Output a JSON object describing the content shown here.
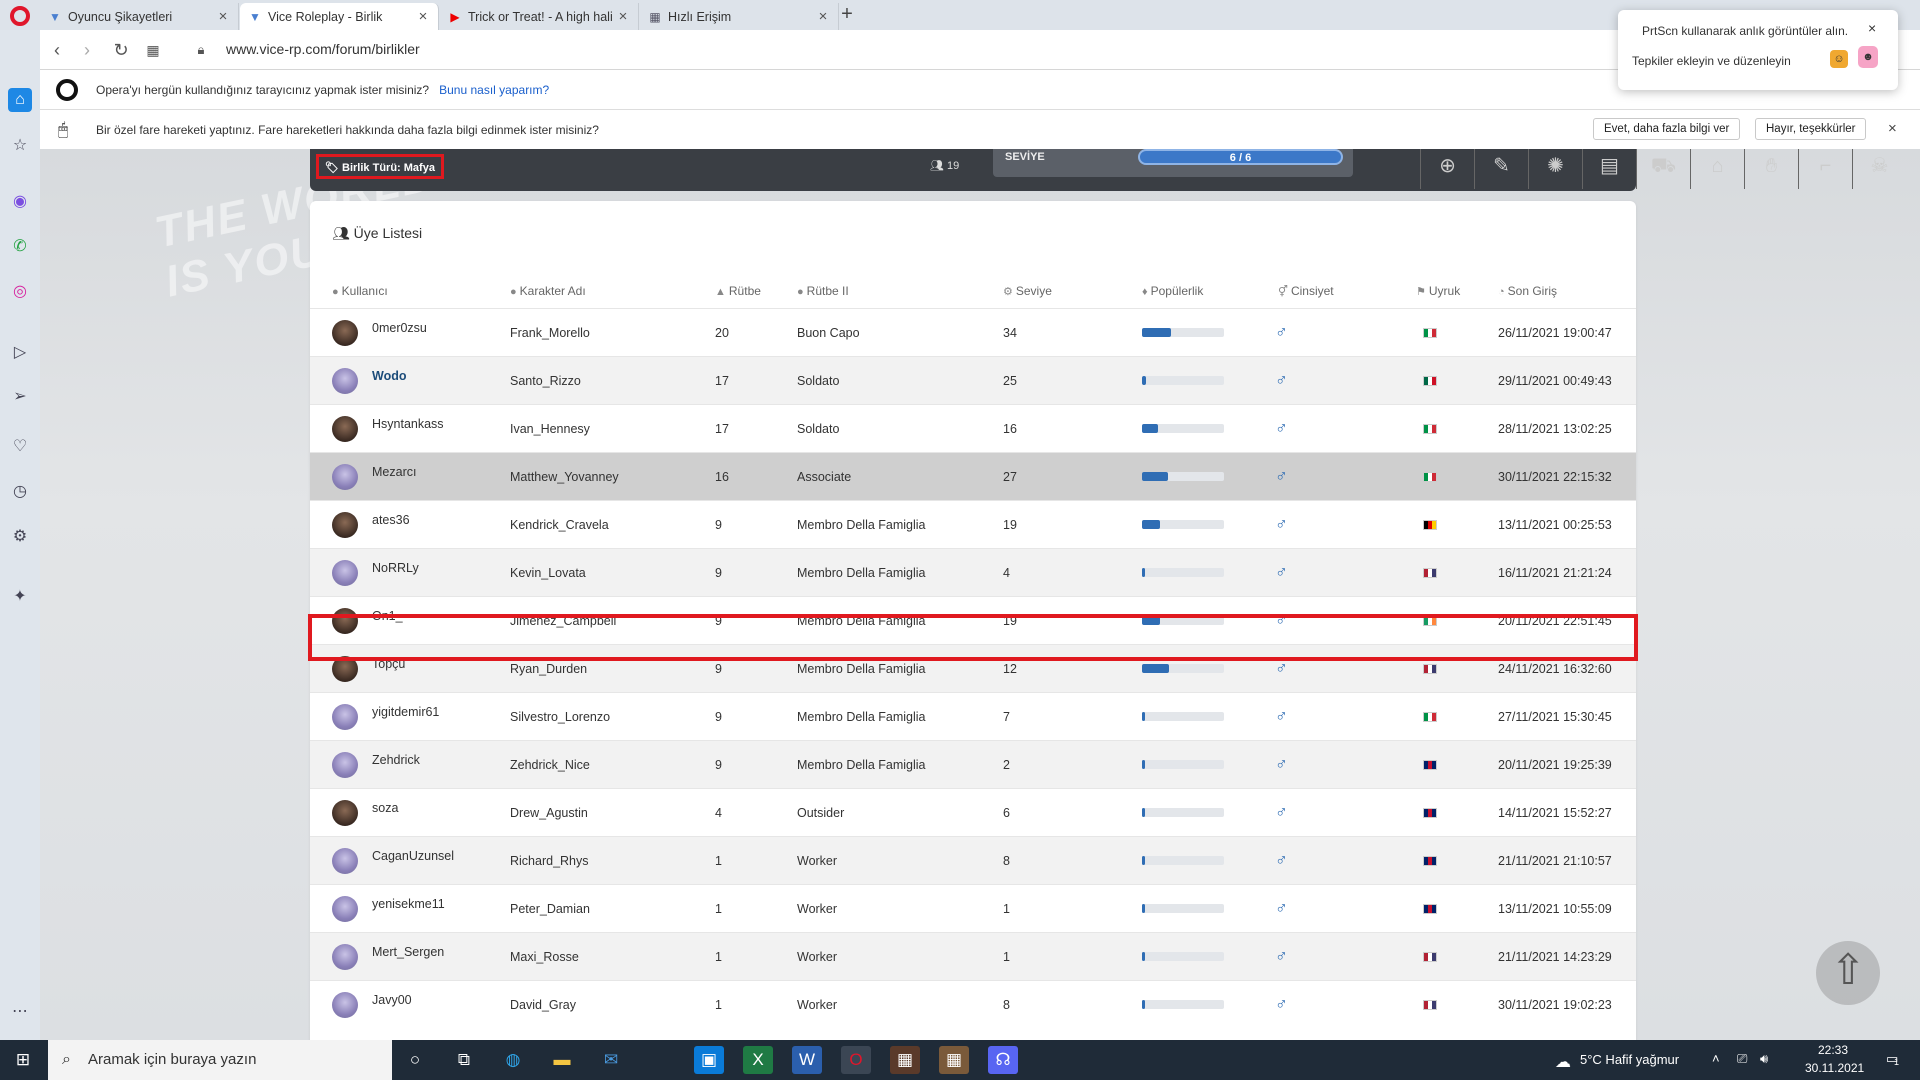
{
  "browser": {
    "tabs": [
      {
        "title": "Oyuncu Şikayetleri",
        "active": false
      },
      {
        "title": "Vice Roleplay - Birlik",
        "active": true
      },
      {
        "title": "Trick or Treat! - A high hali",
        "active": false
      },
      {
        "title": "Hızlı Erişim",
        "active": false
      }
    ],
    "url": "www.vice-rp.com/forum/birlikler",
    "infobar1": {
      "text": "Opera'yı hergün kullandığınız tarayıcınız yapmak ister misiniz?",
      "link": "Bunu nasıl yaparım?"
    },
    "infobar2": {
      "text": "Bir özel fare hareketi yaptınız. Fare hareketleri hakkında daha fazla bilgi edinmek ister misiniz?",
      "yes": "Evet, daha fazla bilgi ver",
      "no": "Hayır, teşekkürler"
    }
  },
  "notification": {
    "line1": "PrtScn kullanarak anlık görüntüler alın.",
    "line2": "Tepkiler ekleyin ve düzenleyin"
  },
  "header": {
    "birlik_turu_label": "Birlik Türü:",
    "birlik_turu_value": "Mafya",
    "member_count": "19",
    "seviye_label": "SEVİYE",
    "seviye_value": "6 / 6"
  },
  "card": {
    "title": "Üye Listesi",
    "columns": [
      "Kullanıcı",
      "Karakter Adı",
      "Rütbe",
      "Rütbe II",
      "Seviye",
      "Popülerlik",
      "Cinsiyet",
      "Uyruk",
      "Son Giriş"
    ],
    "rows": [
      {
        "user": "0mer0zsu",
        "char": "Frank_Morello",
        "rank": "20",
        "rank2": "Buon Capo",
        "level": "34",
        "pop": 0.35,
        "flag": "it",
        "last": "26/11/2021 19:00:47",
        "real": true
      },
      {
        "user": "Wodo",
        "char": "Santo_Rizzo",
        "rank": "17",
        "rank2": "Soldato",
        "level": "25",
        "pop": 0.05,
        "flag": "mx",
        "last": "29/11/2021 00:49:43",
        "bold": true
      },
      {
        "user": "Hsyntankass",
        "char": "Ivan_Hennesy",
        "rank": "17",
        "rank2": "Soldato",
        "level": "16",
        "pop": 0.2,
        "flag": "it",
        "last": "28/11/2021 13:02:25",
        "real": true
      },
      {
        "user": "Mezarcı",
        "char": "Matthew_Yovanney",
        "rank": "16",
        "rank2": "Associate",
        "level": "27",
        "pop": 0.32,
        "flag": "it",
        "last": "30/11/2021 22:15:32"
      },
      {
        "user": "ates36",
        "char": "Kendrick_Cravela",
        "rank": "9",
        "rank2": "Membro Della Famiglia",
        "level": "19",
        "pop": 0.22,
        "flag": "de",
        "last": "13/11/2021 00:25:53",
        "real": true
      },
      {
        "user": "NoRRLy",
        "char": "Kevin_Lovata",
        "rank": "9",
        "rank2": "Membro Della Famiglia",
        "level": "4",
        "pop": 0.04,
        "flag": "us",
        "last": "16/11/2021 21:21:24"
      },
      {
        "user": "On1_",
        "char": "Jimenez_Campbell",
        "rank": "9",
        "rank2": "Membro Della Famiglia",
        "level": "19",
        "pop": 0.22,
        "flag": "ie",
        "last": "20/11/2021 22:51:45",
        "real": true
      },
      {
        "user": "Topçu",
        "char": "Ryan_Durden",
        "rank": "9",
        "rank2": "Membro Della Famiglia",
        "level": "12",
        "pop": 0.33,
        "flag": "us",
        "last": "24/11/2021 16:32:60",
        "real": true
      },
      {
        "user": "yigitdemir61",
        "char": "Silvestro_Lorenzo",
        "rank": "9",
        "rank2": "Membro Della Famiglia",
        "level": "7",
        "pop": 0.04,
        "flag": "it",
        "last": "27/11/2021 15:30:45"
      },
      {
        "user": "Zehdrick",
        "char": "Zehdrick_Nice",
        "rank": "9",
        "rank2": "Membro Della Famiglia",
        "level": "2",
        "pop": 0.04,
        "flag": "gb",
        "last": "20/11/2021 19:25:39"
      },
      {
        "user": "soza",
        "char": "Drew_Agustin",
        "rank": "4",
        "rank2": "Outsider",
        "level": "6",
        "pop": 0.04,
        "flag": "gb",
        "last": "14/11/2021 15:52:27",
        "real": true
      },
      {
        "user": "CaganUzunsel",
        "char": "Richard_Rhys",
        "rank": "1",
        "rank2": "Worker",
        "level": "8",
        "pop": 0.04,
        "flag": "gb",
        "last": "21/11/2021 21:10:57"
      },
      {
        "user": "yenisekme11",
        "char": "Peter_Damian",
        "rank": "1",
        "rank2": "Worker",
        "level": "1",
        "pop": 0.04,
        "flag": "gb",
        "last": "13/11/2021 10:55:09"
      },
      {
        "user": "Mert_Sergen",
        "char": "Maxi_Rosse",
        "rank": "1",
        "rank2": "Worker",
        "level": "1",
        "pop": 0.04,
        "flag": "us",
        "last": "21/11/2021 14:23:29"
      },
      {
        "user": "Javy00",
        "char": "David_Gray",
        "rank": "1",
        "rank2": "Worker",
        "level": "8",
        "pop": 0.04,
        "flag": "us",
        "last": "30/11/2021 19:02:23"
      }
    ]
  },
  "taskbar": {
    "search_placeholder": "Aramak için buraya yazın",
    "weather": "5°C  Hafif yağmur",
    "time": "22:33",
    "date": "30.11.2021",
    "notif_count": "1"
  },
  "colors": {
    "accent": "#2f6db4",
    "highlight": "#e0191f"
  }
}
